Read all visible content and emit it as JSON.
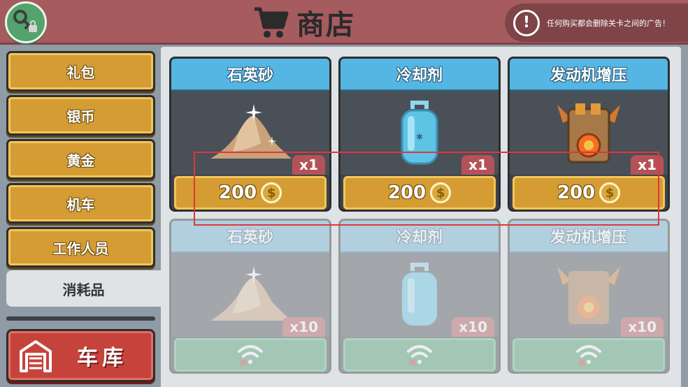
{
  "header": {
    "title": "商店",
    "notice": "任何购买都会删除关卡之间的广告！",
    "notice_icon": "!"
  },
  "sidebar": {
    "items": [
      {
        "label": "礼包"
      },
      {
        "label": "银币"
      },
      {
        "label": "黄金"
      },
      {
        "label": "机车"
      },
      {
        "label": "工作人员"
      }
    ],
    "active_tab": "消耗品",
    "garage_label": "车库"
  },
  "products": [
    {
      "name": "石英砂",
      "qty": "x1",
      "price": "200",
      "coin_symbol": "$",
      "icon": "sand-pile-icon"
    },
    {
      "name": "冷却剂",
      "qty": "x1",
      "price": "200",
      "coin_symbol": "$",
      "icon": "coolant-tank-icon"
    },
    {
      "name": "发动机增压",
      "qty": "x1",
      "price": "200",
      "coin_symbol": "$",
      "icon": "engine-boost-icon"
    }
  ],
  "offline_products": [
    {
      "name": "石英砂",
      "qty": "x10",
      "icon": "sand-pile-icon"
    },
    {
      "name": "冷却剂",
      "qty": "x10",
      "icon": "coolant-tank-icon"
    },
    {
      "name": "发动机增压",
      "qty": "x10",
      "icon": "engine-boost-icon"
    }
  ],
  "colors": {
    "header_bg": "#a65b5e",
    "gold_button": "#d49c32",
    "card_title": "#55b6e3",
    "garage_button": "#c6433c",
    "highlight": "#e0363b"
  }
}
